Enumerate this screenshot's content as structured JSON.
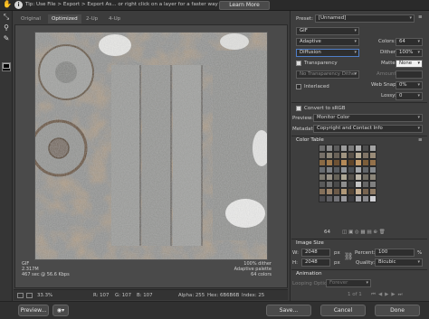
{
  "tipbar": {
    "tip_text": "Tip: Use File > Export > Export As...  or right click on a layer for a faster way to export assets",
    "learn_more": "Learn More"
  },
  "tools": [
    "hand-icon",
    "slice-select-icon",
    "zoom-icon",
    "eyedropper-icon"
  ],
  "tabs": [
    "Original",
    "Optimized",
    "2-Up",
    "4-Up"
  ],
  "image_info": {
    "format": "GIF",
    "size": "2.317M",
    "time": "467 sec @ 56.6 Kbps",
    "dither": "100% dither",
    "palette": "Adaptive palette",
    "colors": "64 colors"
  },
  "status": {
    "zoom": "33.3%",
    "r": "R: 107",
    "g": "G: 107",
    "b": "B: 107",
    "alpha": "Alpha: 255",
    "hex": "Hex: 6B6B6B",
    "index": "Index: 25"
  },
  "panel": {
    "preset_label": "Preset:",
    "preset_value": "[Unnamed]",
    "format_value": "GIF",
    "reduction_value": "Adaptive",
    "dither_algo_value": "Diffusion",
    "colors_label": "Colors:",
    "colors_value": "64",
    "dither_label": "Dither:",
    "dither_value": "100%",
    "transparency_label": "Transparency",
    "matte_label": "Matte:",
    "matte_value": "None",
    "trans_dither_value": "No Transparency Dither",
    "amount_label": "Amount:",
    "interlaced_label": "Interlaced",
    "websnap_label": "Web Snap:",
    "websnap_value": "0%",
    "lossy_label": "Lossy:",
    "lossy_value": "0",
    "convert_srgb_label": "Convert to sRGB",
    "preview_label": "Preview:",
    "preview_value": "Monitor Color",
    "metadata_label": "Metadata:",
    "metadata_value": "Copyright and Contact Info",
    "color_table_label": "Color Table",
    "color_count": "64",
    "image_size_label": "Image Size",
    "w_label": "W:",
    "w_value": "2048",
    "h_label": "H:",
    "h_value": "2048",
    "px": "px",
    "percent_label": "Percent:",
    "percent_value": "100",
    "percent_unit": "%",
    "quality_label": "Quality:",
    "quality_value": "Bicubic",
    "animation_label": "Animation",
    "looping_label": "Looping Options:",
    "looping_value": "Forever",
    "frame_counter": "1 of 1"
  },
  "bottom": {
    "preview_btn": "Preview...",
    "save_btn": "Save...",
    "cancel_btn": "Cancel",
    "done_btn": "Done"
  },
  "palette_colors": [
    "#6e6e6e",
    "#8a8a8a",
    "#5c5c5c",
    "#9c9c9c",
    "#7a7a7a",
    "#b0b0b0",
    "#4e4e4e",
    "#a4a4a4",
    "#767068",
    "#8e8678",
    "#6a6258",
    "#a09480",
    "#5a5248",
    "#b8ac96",
    "#807466",
    "#9a8c78",
    "#8a6a44",
    "#a07a4c",
    "#6e5234",
    "#b48a58",
    "#5e4428",
    "#c29a68",
    "#7c5e3a",
    "#94714a",
    "#686c70",
    "#7c8084",
    "#585c60",
    "#909498",
    "#4a4e52",
    "#a4a8ac",
    "#62666a",
    "#868a8e",
    "#7e7a70",
    "#969084",
    "#666258",
    "#aca694",
    "#54504a",
    "#bcb6a8",
    "#726e64",
    "#8c867a",
    "#5a5a5a",
    "#727272",
    "#4a4a4a",
    "#8e8e8e",
    "#3e3e3e",
    "#c4c4c4",
    "#666666",
    "#808080",
    "#84705a",
    "#9c846a",
    "#6c5a48",
    "#b09878",
    "#564636",
    "#c6ae90",
    "#786450",
    "#907c66",
    "#4c4c50",
    "#606064",
    "#747478",
    "#98989c",
    "#3c3c40",
    "#acacb0",
    "#88888c",
    "#d0d0d4"
  ]
}
